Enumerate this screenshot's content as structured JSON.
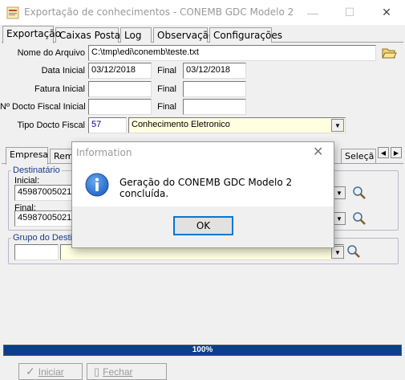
{
  "window": {
    "title": "Exportação de conhecimentos - CONEMB GDC Modelo 2",
    "minimize_glyph": "—",
    "maximize_glyph": "☐",
    "close_glyph": "✕"
  },
  "tabs": [
    {
      "label": "Exportação",
      "active": true
    },
    {
      "label": "Caixas Postais",
      "active": false
    },
    {
      "label": "Log",
      "active": false
    },
    {
      "label": "Observação",
      "active": false
    },
    {
      "label": "Configurações",
      "active": false
    }
  ],
  "form": {
    "file_label": "Nome do Arquivo",
    "file_value": "C:\\tmp\\edi\\conemb\\teste.txt",
    "date_initial_label": "Data Inicial",
    "date_initial_value": "03/12/2018",
    "date_final_label": "Final",
    "date_final_value": "03/12/2018",
    "invoice_initial_label": "Fatura Inicial",
    "invoice_initial_value": "",
    "invoice_final_label": "Final",
    "invoice_final_value": "",
    "fiscal_doc_initial_label": "Nº Docto Fiscal Inicial",
    "fiscal_doc_initial_value": "",
    "fiscal_doc_final_label": "Final",
    "fiscal_doc_final_value": "",
    "doc_type_label": "Tipo Docto Fiscal",
    "doc_type_code": "57",
    "doc_type_value": "Conhecimento Eletronico"
  },
  "subtabs": {
    "first": "Empresa",
    "second_partial": "Reme",
    "last_partial": "Seleçã",
    "prev_arrow": "◀",
    "next_arrow": "▶"
  },
  "destinatario": {
    "group_label": "Destinatário",
    "initial_label": "Inicial:",
    "initial_value": "459870050218",
    "final_label": "Final:",
    "final_value": "459870050218"
  },
  "grupo": {
    "group_label": "Grupo do Desti",
    "code_value": "",
    "name_value": ""
  },
  "progress": {
    "percent": 100,
    "text": "100%"
  },
  "bottom_buttons": {
    "start_label": "Iniciar",
    "close_label": "Fechar"
  },
  "dialog": {
    "title": "Information",
    "message": "Geração do CONEMB GDC Modelo 2 concluída.",
    "ok_label": "OK",
    "close_glyph": "✕"
  },
  "colors": {
    "progress_fill": "#0a3f8c",
    "highlight_field": "#ffffe1",
    "info_icon": "#1f63c6",
    "dialog_focus": "#0078d7"
  }
}
